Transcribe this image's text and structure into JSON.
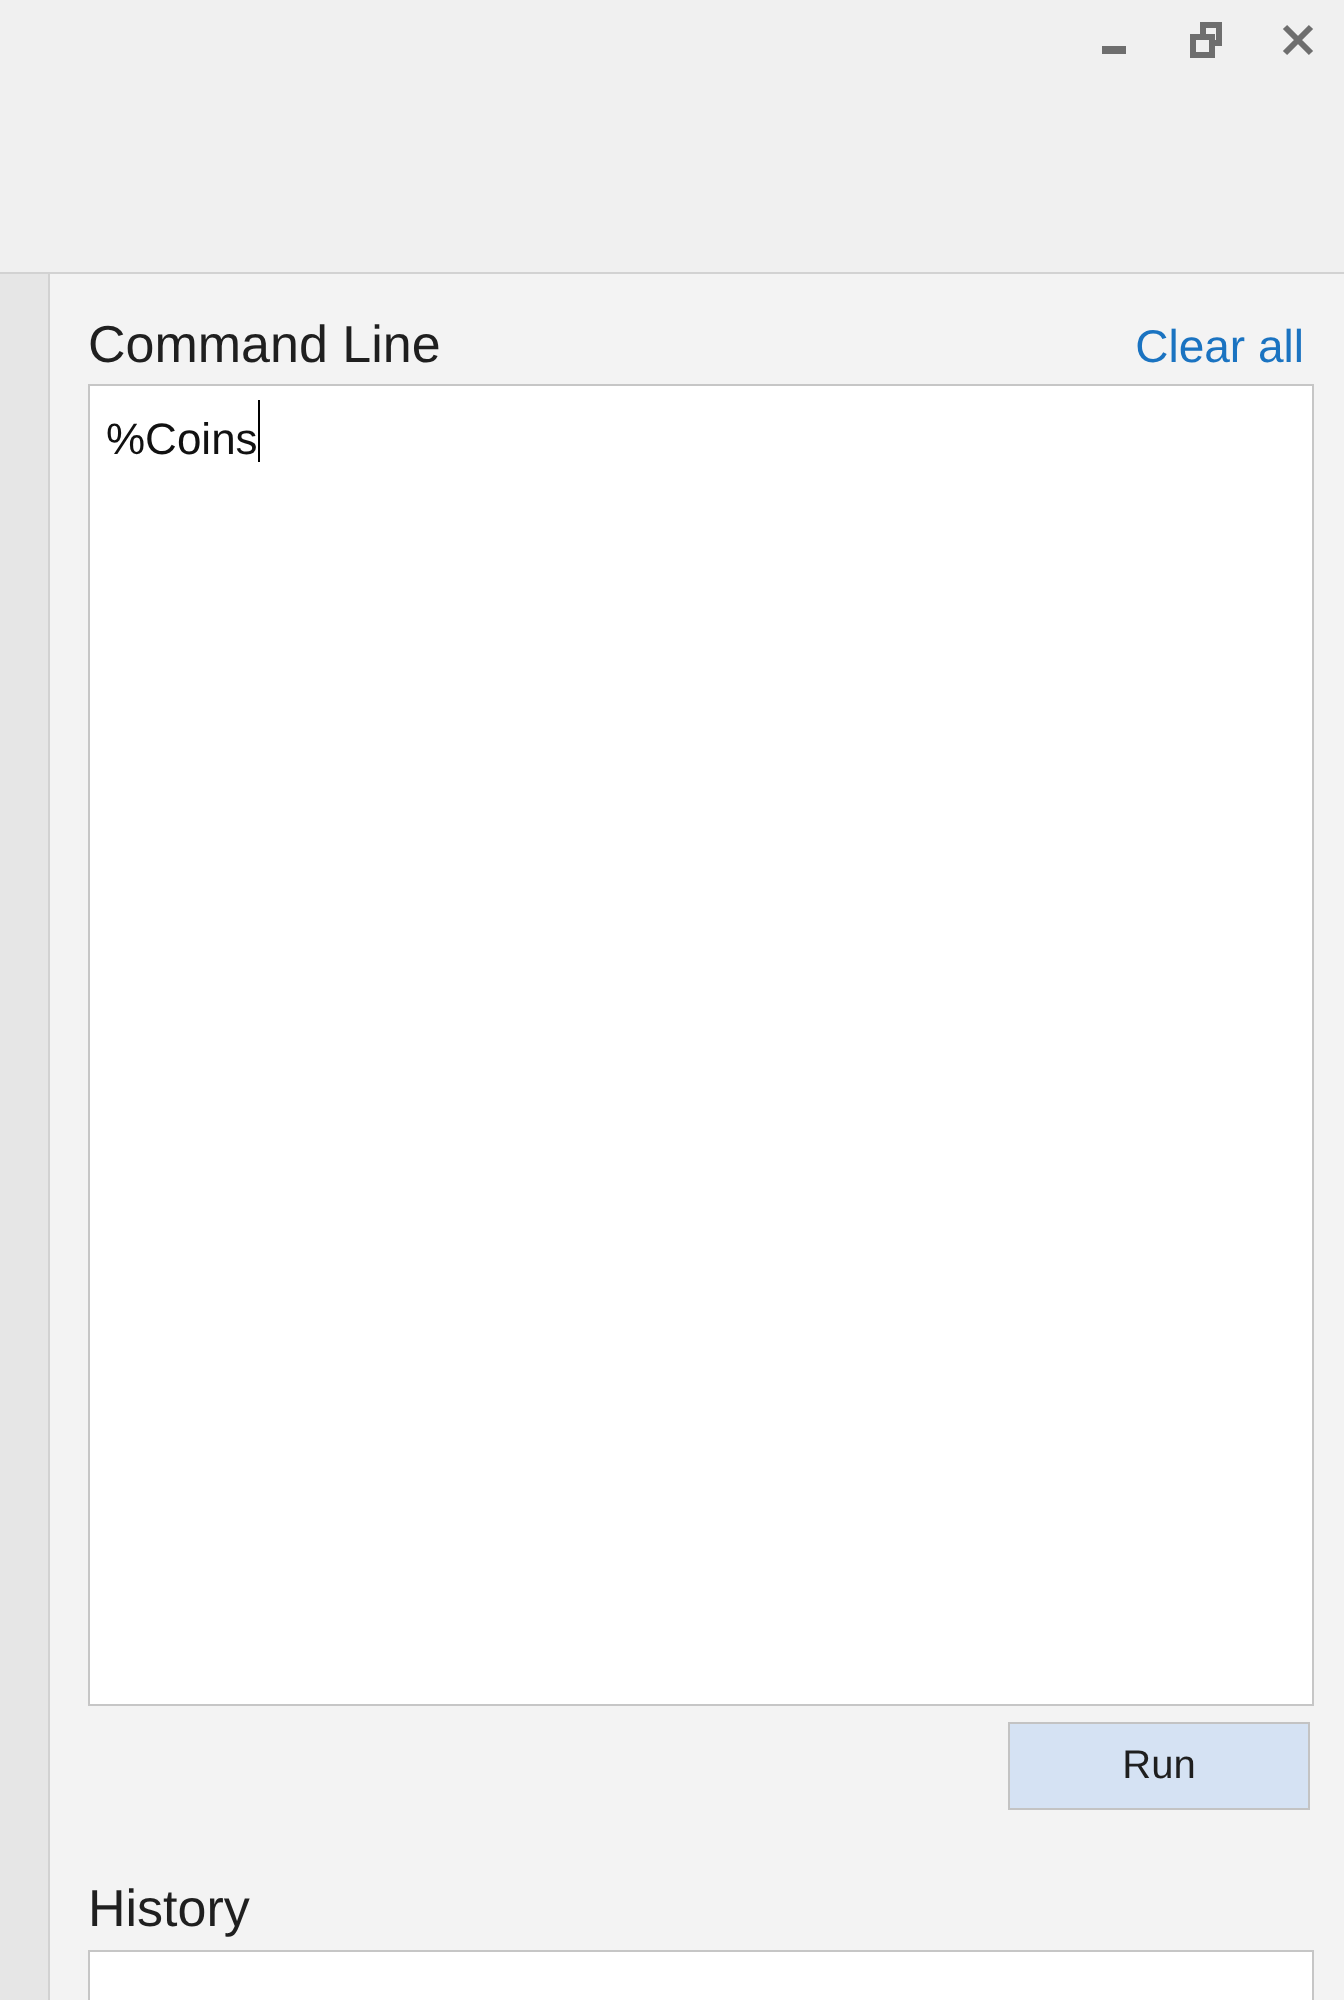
{
  "window": {
    "controls": [
      {
        "kind": "minimize"
      },
      {
        "kind": "restore"
      },
      {
        "kind": "close"
      }
    ]
  },
  "command_line": {
    "title": "Command Line",
    "clear_link": "Clear all",
    "input": {
      "value": "%Coins",
      "focused": true
    },
    "run_button": "Run"
  },
  "history": {
    "title": "History"
  }
}
